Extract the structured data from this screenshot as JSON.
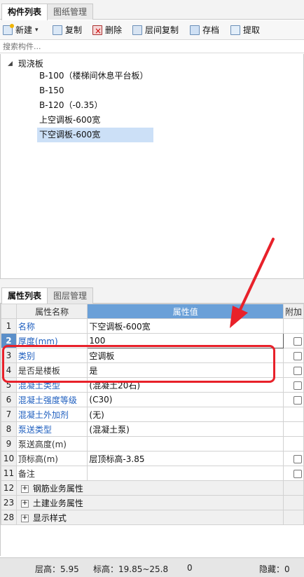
{
  "top_tabs": [
    "构件列表",
    "图纸管理"
  ],
  "toolbar": {
    "new": "新建",
    "copy": "复制",
    "delete": "删除",
    "floor_copy": "层间复制",
    "archive": "存档",
    "extract": "提取"
  },
  "search": {
    "placeholder": "搜索构件..."
  },
  "tree": {
    "root": "现浇板",
    "items": [
      "B-100（楼梯间休息平台板）",
      "B-150",
      "B-120（-0.35）",
      "上空调板-600宽",
      "下空调板-600宽"
    ],
    "selected_index": 4
  },
  "prop_tabs": [
    "属性列表",
    "图层管理"
  ],
  "grid": {
    "headers": [
      "属性名称",
      "属性值",
      "附加"
    ],
    "rows": [
      {
        "num": "1",
        "name": "名称",
        "value": "下空调板-600宽",
        "blue": true,
        "checkbox": false
      },
      {
        "num": "2",
        "name": "厚度(mm)",
        "value": "100",
        "blue": true,
        "checkbox": true
      },
      {
        "num": "3",
        "name": "类别",
        "value": "空调板",
        "blue": true,
        "checkbox": true
      },
      {
        "num": "4",
        "name": "是否是楼板",
        "value": "是",
        "blue": false,
        "checkbox": true
      },
      {
        "num": "5",
        "name": "混凝土类型",
        "value": "(混凝土20石)",
        "blue": true,
        "checkbox": true
      },
      {
        "num": "6",
        "name": "混凝土强度等级",
        "value": "(C30)",
        "blue": true,
        "checkbox": true
      },
      {
        "num": "7",
        "name": "混凝土外加剂",
        "value": "(无)",
        "blue": true,
        "checkbox": false
      },
      {
        "num": "8",
        "name": "泵送类型",
        "value": "(混凝土泵)",
        "blue": true,
        "checkbox": false
      },
      {
        "num": "9",
        "name": "泵送高度(m)",
        "value": "",
        "blue": false,
        "checkbox": false
      },
      {
        "num": "10",
        "name": "顶标高(m)",
        "value": "层顶标高-3.85",
        "blue": false,
        "checkbox": true
      },
      {
        "num": "11",
        "name": "备注",
        "value": "",
        "blue": false,
        "checkbox": true
      }
    ],
    "groups": [
      {
        "num": "12",
        "name": "钢筋业务属性"
      },
      {
        "num": "23",
        "name": "土建业务属性"
      },
      {
        "num": "28",
        "name": "显示样式"
      }
    ]
  },
  "status": {
    "floor_height": "层高：5.95",
    "elevation": "标高：19.85~25.8",
    "zero": "0",
    "hidden": "隐藏：0"
  },
  "colors": {
    "annotation": "#e8212a",
    "header_highlight": "#6aa0d8",
    "blue_text": "#1f5fbf"
  }
}
